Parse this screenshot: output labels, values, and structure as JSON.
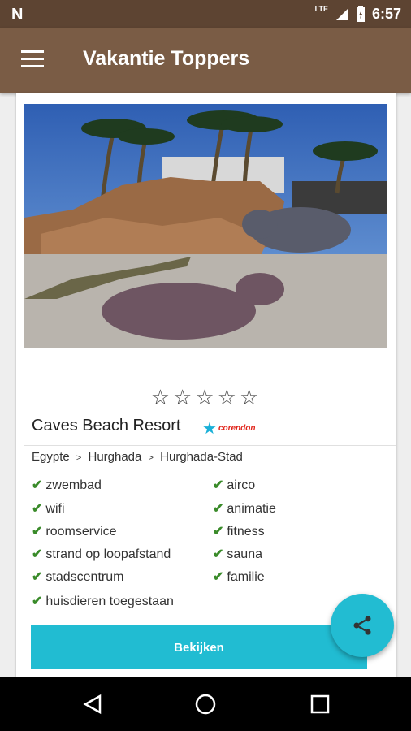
{
  "status": {
    "time": "6:57",
    "network": "LTE"
  },
  "app": {
    "title": "Vakantie Toppers"
  },
  "hotel": {
    "name": "Caves Beach Resort",
    "rating_stars": "☆☆☆☆☆",
    "brand": "corendon",
    "breadcrumb": [
      "Egypte",
      "Hurghada",
      "Hurghada-Stad"
    ],
    "breadcrumb_separator": ">",
    "features_left": [
      "zwembad",
      "wifi",
      "roomservice",
      "strand op loopafstand",
      "stadscentrum",
      "huisdieren toegestaan"
    ],
    "features_right": [
      "airco",
      "animatie",
      "fitness",
      "sauna",
      "familie"
    ],
    "check_icon": "✔"
  },
  "actions": {
    "view_label": "Bekijken"
  },
  "colors": {
    "primary": "#7a5c45",
    "status": "#5d4432",
    "accent": "#22bcd2",
    "check": "#3a8b2a"
  }
}
